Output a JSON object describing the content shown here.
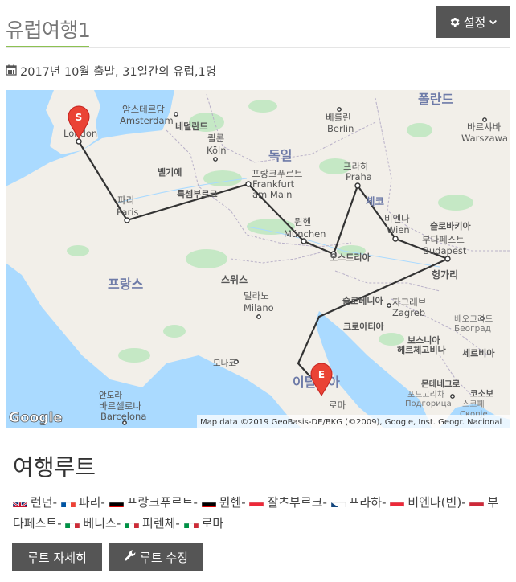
{
  "header": {
    "title": "유럽여행1",
    "settings_label": "설정",
    "settings_icon": "gear-icon",
    "settings_caret_icon": "chevron-down-icon"
  },
  "trip": {
    "subtitle": "2017년 10월 출발, 31일간의 유럽,1명",
    "subtitle_icon": "calendar-icon"
  },
  "map": {
    "attribution": "Map data ©2019 GeoBasis-DE/BKG (©2009), Google, Inst. Geogr. Nacional",
    "logo": "Google",
    "start_marker": "S",
    "end_marker": "E",
    "route_color": "#333333",
    "marker_color": "#ea4335",
    "labels": {
      "poland": "폴란드",
      "amsterdam_ko": "암스테르담",
      "amsterdam": "Amsterdam",
      "netherlands": "네덜란드",
      "berlin_ko": "베를린",
      "berlin": "Berlin",
      "warsaw_ko": "바르샤바",
      "warsaw": "Warszawa",
      "london": "London",
      "cologne_ko": "쾰른",
      "cologne": "Köln",
      "germany": "독일",
      "belgium": "벨기에",
      "frankfurt_ko": "프랑크푸르트",
      "frankfurt": "Frankfurt",
      "frankfurt2": "am Main",
      "prague_ko": "프라하",
      "prague": "Praha",
      "luxembourg": "룩셈부르크",
      "paris_ko": "파리",
      "paris": "Paris",
      "czech": "체코",
      "slovakia": "슬로바키아",
      "vienna_ko": "비엔나",
      "vienna": "Wien",
      "munich_ko": "뮌헨",
      "munich": "München",
      "budapest_ko": "부다페스트",
      "budapest": "Budapest",
      "austria": "오스트리아",
      "hungary": "헝가리",
      "france": "프랑스",
      "switzerland": "스위스",
      "milan_ko": "밀라노",
      "milan": "Milano",
      "slovenia": "슬로베니아",
      "zagreb_ko": "자그레브",
      "zagreb": "Zagreb",
      "belgrade_ko": "베오그라드",
      "belgrade": "Београд",
      "croatia": "크로아티아",
      "bosnia1": "보스니아",
      "bosnia2": "헤르체고비나",
      "serbia": "세르비아",
      "monaco": "모나코",
      "italy": "이탈리아",
      "montenegro": "몬테네그로",
      "podgorica_ko": "포드고리차",
      "podgorica": "Подгорица",
      "kosovo": "코소보",
      "skopje_ko": "스코페",
      "skopje": "Скопје",
      "andorra": "안도라",
      "barcelona_ko": "바르셀로나",
      "barcelona": "Barcelona",
      "rome_ko": "로마"
    }
  },
  "route": {
    "title": "여행루트",
    "stops": [
      {
        "name": "런던",
        "flag": "uk"
      },
      {
        "name": "파리",
        "flag": "fr"
      },
      {
        "name": "프랑크푸르트",
        "flag": "de"
      },
      {
        "name": "뮌헨",
        "flag": "de"
      },
      {
        "name": "잘츠부르크",
        "flag": "at"
      },
      {
        "name": "프라하",
        "flag": "cz"
      },
      {
        "name": "비엔나(빈)",
        "flag": "at"
      },
      {
        "name": "부다페스트",
        "flag": "hu"
      },
      {
        "name": "베니스",
        "flag": "it"
      },
      {
        "name": "피렌체",
        "flag": "it"
      },
      {
        "name": "로마",
        "flag": "it"
      }
    ],
    "separator": "-"
  },
  "buttons": {
    "detail_label": "루트 자세히",
    "edit_label": "루트 수정",
    "edit_icon": "wrench-icon"
  }
}
